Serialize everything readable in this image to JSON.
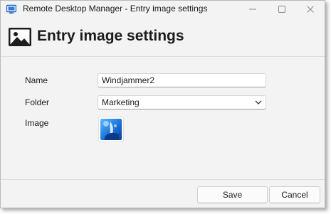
{
  "window": {
    "title": "Remote Desktop Manager - Entry image settings"
  },
  "header": {
    "title": "Entry image settings",
    "icon": "image-icon"
  },
  "form": {
    "name_label": "Name",
    "name_value": "Windjammer2",
    "folder_label": "Folder",
    "folder_value": "Marketing",
    "image_label": "Image"
  },
  "footer": {
    "save_label": "Save",
    "cancel_label": "Cancel"
  },
  "colors": {
    "window_bg": "#f3f3f3",
    "accent_blue": "#1f6fd1"
  }
}
